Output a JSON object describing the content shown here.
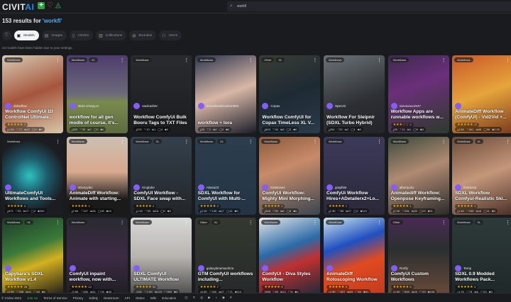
{
  "header": {
    "logo_a": "CIVIT",
    "logo_b": "AI",
    "search_value": "workfl"
  },
  "results": {
    "prefix": "153 results for ",
    "query": "'workfl'"
  },
  "tabs": [
    {
      "label": "Models",
      "icon": "models-icon"
    },
    {
      "label": "Images",
      "icon": "images-icon"
    },
    {
      "label": "Articles",
      "icon": "articles-icon"
    },
    {
      "label": "Collections",
      "icon": "collections-icon"
    },
    {
      "label": "Bounties",
      "icon": "bounties-icon"
    },
    {
      "label": "Users",
      "icon": "users-icon"
    }
  ],
  "hidden_note": "24 models have been hidden due to your settings.",
  "cards": [
    {
      "badges": [
        "Workflows"
      ],
      "creator": "dnbwflow",
      "title": "Workflow ComfyUi I2I ControlNet Ultimate...",
      "stars": "★★★★★",
      "count": "3",
      "stats": [
        "1.5K",
        "77",
        "12",
        "0",
        "0"
      ],
      "bg": "linear-gradient(160deg,#d8cbb5,#a5553c 50%,#d9c6a8)"
    },
    {
      "badges": [
        "Workflows",
        "XL"
      ],
      "creator": "4542.creepy.ai",
      "title": "workflow for all gen modle of course, it's...",
      "stars": "",
      "count": "",
      "stats": [
        "383",
        "35",
        "2",
        "0",
        "0"
      ],
      "bg": "linear-gradient(180deg,#4e3c6e 0%,#6d6a7a 50%,#7a8a4e 60%,#5d6b3f)"
    },
    {
      "badges": [
        "Workflows"
      ],
      "creator": "saulcasher",
      "title": "Workflow ComfyUi Bulk Booru Tags to TXT Files",
      "stars": "",
      "count": "",
      "stats": [
        "229",
        "10",
        "1",
        "4",
        "0"
      ],
      "bg": "linear-gradient(180deg,#2a2b2e,#1c1d1f)"
    },
    {
      "badges": [
        "Workflows"
      ],
      "creator": "hanashiwebcarbon950",
      "title": "workflow + lora",
      "stars": "",
      "count": "",
      "stats": [
        "53",
        "2",
        "0",
        "0",
        "0"
      ],
      "bg": "linear-gradient(160deg,#2b3550,#d9b7a6 50%,#1b1d2a)"
    },
    {
      "badges": [
        "Other",
        "XL"
      ],
      "creator": "Copax",
      "title": "Workflow ComfyUI for Copax TimeLess XL V...",
      "stars": "",
      "count": "",
      "stats": [
        "843",
        "40",
        "5",
        "3",
        "0"
      ],
      "bg": "linear-gradient(160deg,#3a3d35,#1e2a33 50%,#2c3b4a)"
    },
    {
      "badges": [
        "Workflows"
      ],
      "creator": "Spec22",
      "title": "Workflow For Sleipnir (SDXL Turbo Hybrid)",
      "stars": "",
      "count": "",
      "stats": [
        "254",
        "20",
        "2",
        "1",
        "0"
      ],
      "bg": "linear-gradient(160deg,#6b7278,#2c2f33 60%,#22252a)"
    },
    {
      "badges": [
        "Workflows"
      ],
      "creator": "naruexaoor547",
      "title": "Workflow Apps are runnable workflows w...",
      "stars": "★★★☆☆",
      "count": "2",
      "stats": [
        "35",
        "11",
        "1",
        "0",
        "0"
      ],
      "bg": "linear-gradient(160deg,#3d2a4f,#6b2f7a 40%,#2d3a2c)"
    },
    {
      "badges": [
        "Workflows"
      ],
      "creator": "",
      "title": "AnimateDiff Workflow (ComfyUI) - Vid2Vid +...",
      "stars": "★★★★★",
      "count": "17",
      "stats": [
        "4.8K",
        "661",
        "58",
        "98",
        "2.2K"
      ],
      "bg": "linear-gradient(160deg,#c9572a,#e7a43c 50%,#7a3b1e)"
    },
    {
      "badges": [
        "Workflows"
      ],
      "creator": "",
      "title": "UltimateComfyUI Workflows and Tools...",
      "stars": "★★★★★",
      "count": "3",
      "stats": [
        "873",
        "53",
        "17",
        "4",
        "200"
      ],
      "bg": "radial-gradient(circle at 45% 50%,#2fc2c2,#1d5a6b 35%,#1c1d22 70%)"
    },
    {
      "badges": [
        "Workflows"
      ],
      "creator": "sDanyyibo",
      "title": "AnimateDiff Workflow: Animate with starting...",
      "stars": "★★★★★",
      "count": "3",
      "stats": [
        "2.6K",
        "127",
        "36",
        "28",
        "10"
      ],
      "bg": "linear-gradient(180deg,#cbbfb3,#d9a98e 45%,#1a1a1a 80%)"
    },
    {
      "badges": [
        "Workflows",
        "XL"
      ],
      "creator": "Kinglabe",
      "title": "ComfyUI Workflow - SDXL Face swap with...",
      "stars": "★★★★★",
      "count": "2",
      "stats": [
        "1.1K",
        "53",
        "18",
        "0",
        "0"
      ],
      "bg": "linear-gradient(180deg,#34404c,#222629)"
    },
    {
      "badges": [
        "Workflows",
        "XL"
      ],
      "creator": "Akasa23",
      "title": "SDXL Workflow for ComfyUI with Multi-...",
      "stars": "★★★★★",
      "count": "2",
      "stats": [
        "2.1K",
        "145",
        "17",
        "11",
        "0"
      ],
      "bg": "linear-gradient(180deg,#2c3e4e,#243444)"
    },
    {
      "badges": [
        "Workflows"
      ],
      "creator": "kisskisses",
      "title": "ComfyUI Workflow: Mighty Mini Morphing...",
      "stars": "★★★★★",
      "count": "1",
      "stats": [
        "308",
        "50",
        "6",
        "8",
        "0"
      ],
      "bg": "linear-gradient(160deg,#8a5a3c,#c88b6a 40%,#3a4550)"
    },
    {
      "badges": [
        "Workflows"
      ],
      "creator": "graphite",
      "title": "ComfyUi Workflow Hires+ADetailerx2+Lo...",
      "stars": "★★★★★",
      "count": "1",
      "stats": [
        "1.9K",
        "85",
        "27",
        "2",
        "121"
      ],
      "bg": "linear-gradient(180deg,#3c3a5a,#2a2838)"
    },
    {
      "badges": [
        "Workflows"
      ],
      "creator": "albertyoko",
      "title": "Animatediff Workflow: Openpose Keyframing...",
      "stars": "★★★★★",
      "count": "1",
      "stats": [
        "2.3K",
        "281",
        "35",
        "23",
        "31"
      ],
      "bg": "linear-gradient(160deg,#3a4a3c,#b08a72 45%,#2a2a2a)"
    },
    {
      "badges": [
        "Workflows",
        "XL"
      ],
      "creator": "fishdonut",
      "title": "SDXL Workflow Comfyui-Realistic Ski...",
      "stars": "★★★★★",
      "count": "1",
      "stats": [
        "1.4K",
        "258",
        "16",
        "11",
        "0"
      ],
      "bg": "linear-gradient(160deg,#6b4a3a,#c4977a 50%,#4a3028)"
    },
    {
      "badges": [
        "Workflows",
        "XL"
      ],
      "creator": "",
      "title": "Capybara's SDXL Workflow v1.4",
      "stars": "★★★★★",
      "count": "28",
      "stats": [
        "2.9K",
        "208",
        "41",
        "30",
        "0"
      ],
      "bg": "linear-gradient(160deg,#1e3a2a,#3a7a3a 40%,#d4b020 60%,#1a1a1a)"
    },
    {
      "badges": [
        "Workflows"
      ],
      "creator": "",
      "title": "ComfyUI inpaint workflow, now with...",
      "stars": "★★★★★",
      "count": "12",
      "stats": [
        "3.5K",
        "286",
        "31",
        "78",
        "45"
      ],
      "bg": "linear-gradient(180deg,#2a2a30,#3d2a45 50%,#1e1e22)"
    },
    {
      "badges": [
        "Workflows"
      ],
      "creator": "",
      "title": "SDXL ComfyUI ULTIMATE Workflow",
      "stars": "★★★★★",
      "count": "52",
      "stats": [
        "10K",
        "1.0K",
        "123",
        "392",
        "3"
      ],
      "bg": "linear-gradient(180deg,#d8d8d8,#b8b4b0 50%,#4a4a4a)"
    },
    {
      "badges": [
        "Other",
        "XL"
      ],
      "creator": "galaxytimemachine",
      "title": "GTM ComfyUI workflows including...",
      "stars": "★★★★★",
      "count": "7",
      "stats": [
        "6.0K",
        "350",
        "27",
        "71",
        "110"
      ],
      "bg": "linear-gradient(180deg,#343a30,#26292a)"
    },
    {
      "badges": [
        "Workflows"
      ],
      "creator": "",
      "title": "ComfyUI - Diva Styles Workflow",
      "stars": "★★★★★",
      "count": "5",
      "stats": [
        "988",
        "65",
        "14",
        "6",
        "0"
      ],
      "bg": "linear-gradient(160deg,#e8e8e8,#2a6aa8 40%,#c03030 60%,#1a2a3a)"
    },
    {
      "badges": [
        "Workflows"
      ],
      "creator": "",
      "title": "AnimateDiff Rotoscoping Workflow",
      "stars": "★★★★★",
      "count": "5",
      "stats": [
        "2.9K",
        "627",
        "63",
        "60",
        "61"
      ],
      "bg": "linear-gradient(160deg,#cfe8ef,#2050c0 35%,#e04a20 60%,#c03a20)"
    },
    {
      "badges": [
        "Other"
      ],
      "creator": "Firefly",
      "title": "ComfyUI Custom Workflows",
      "stars": "★★★★★",
      "count": "5",
      "stats": [
        "4.9K",
        "669",
        "18",
        "29",
        "108"
      ],
      "bg": "linear-gradient(180deg,#4a2a55,#2a2f30 40%,#6a4a3a)"
    },
    {
      "badges": [
        "Workflows",
        "XL"
      ],
      "creator": "Temp",
      "title": "SDXL 0.9 Modded Workflows Pack...",
      "stars": "★★★★★",
      "count": "3",
      "stats": [
        "1.7K",
        "75",
        "6",
        "20",
        "0"
      ],
      "bg": "linear-gradient(180deg,#2e3a3a,#1f2828)"
    }
  ],
  "stat_icons": [
    "⤓",
    "♡",
    "⇋",
    "◯",
    "⬥"
  ],
  "footer": {
    "copyright": "© Civitai 2024",
    "links": [
      "Join Us",
      "Terms of Service",
      "Privacy",
      "Safety",
      "Newsroom",
      "API",
      "Status",
      "Wiki",
      "Education"
    ],
    "icons": [
      "discord-icon",
      "x-icon",
      "instagram-icon",
      "youtube-icon",
      "tiktok-icon",
      "reddit-icon",
      "github-icon"
    ]
  }
}
